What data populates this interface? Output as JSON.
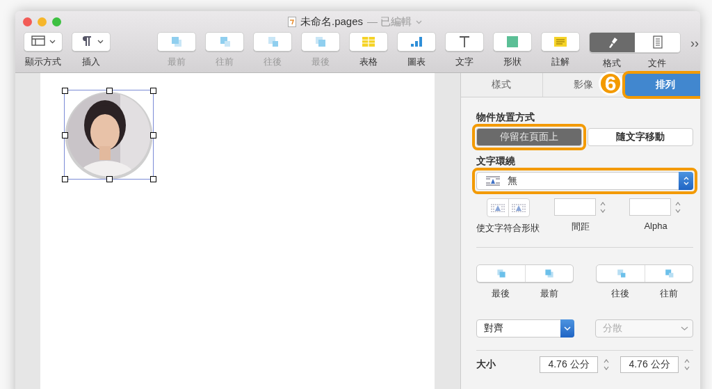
{
  "window": {
    "title": "未命名.pages",
    "status": "— 已編輯"
  },
  "toolbar": [
    {
      "label": "顯示方式",
      "kind": "view",
      "disabled": false,
      "dropdown": true
    },
    {
      "label": "插入",
      "kind": "insert",
      "disabled": false,
      "dropdown": true
    },
    {
      "label": "最前",
      "kind": "front",
      "disabled": true
    },
    {
      "label": "往前",
      "kind": "forward",
      "disabled": true
    },
    {
      "label": "往後",
      "kind": "backward",
      "disabled": true
    },
    {
      "label": "最後",
      "kind": "back",
      "disabled": true
    },
    {
      "label": "表格",
      "kind": "table",
      "disabled": false
    },
    {
      "label": "圖表",
      "kind": "chart",
      "disabled": false
    },
    {
      "label": "文字",
      "kind": "text",
      "disabled": false
    },
    {
      "label": "形狀",
      "kind": "shape",
      "disabled": false
    },
    {
      "label": "註解",
      "kind": "comment",
      "disabled": false
    }
  ],
  "panel_toggle": [
    {
      "label": "格式",
      "kind": "format",
      "selected": true
    },
    {
      "label": "文件",
      "kind": "document",
      "selected": false
    }
  ],
  "overflow_button": "››",
  "inspector": {
    "tabs": [
      {
        "label": "樣式",
        "selected": false,
        "highlighted": false
      },
      {
        "label": "影像",
        "selected": false,
        "highlighted": false
      },
      {
        "label": "排列",
        "selected": true,
        "highlighted": true
      }
    ],
    "step_badge": "6",
    "placement": {
      "title": "物件放置方式",
      "options": [
        {
          "label": "停留在頁面上",
          "selected": true,
          "highlighted": true
        },
        {
          "label": "隨文字移動",
          "selected": false,
          "highlighted": false
        }
      ]
    },
    "wrap": {
      "title": "文字環繞",
      "value": "無",
      "highlighted": true
    },
    "fit_label": "使文字符合形狀",
    "spacing_label": "間距",
    "alpha_label": "Alpha",
    "layer_groups": [
      [
        {
          "label": "最後",
          "kind": "back"
        },
        {
          "label": "最前",
          "kind": "front"
        }
      ],
      [
        {
          "label": "往後",
          "kind": "backward"
        },
        {
          "label": "往前",
          "kind": "forward"
        }
      ]
    ],
    "align": {
      "value": "對齊",
      "disabled": false
    },
    "distribute": {
      "value": "分散",
      "disabled": true
    },
    "size": {
      "label": "大小",
      "width": "4.76 公分",
      "height": "4.76 公分"
    }
  }
}
